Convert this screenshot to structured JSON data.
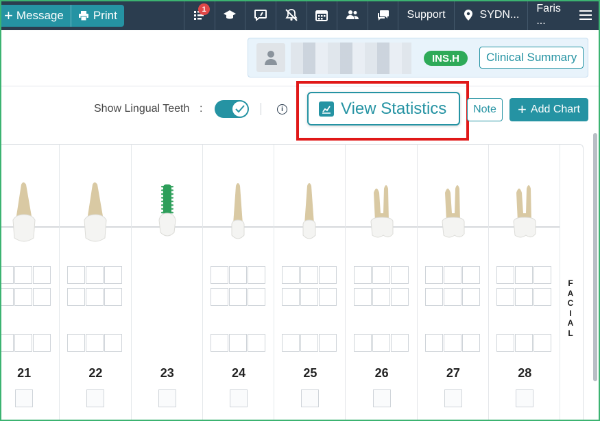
{
  "topnav": {
    "message_label": "Message",
    "print_label": "Print",
    "notification_count": "1",
    "support_label": "Support",
    "location_label": "SYDN...",
    "user_label": "Faris ..."
  },
  "patient": {
    "ins_badge": "INS.H",
    "clinical_summary_label": "Clinical Summary"
  },
  "toolbar": {
    "lingual_label": "Show Lingual Teeth",
    "colon": ":",
    "lingual_enabled": true,
    "view_statistics_label": "View Statistics",
    "note_label": "Note",
    "add_chart_label": "Add Chart"
  },
  "chart": {
    "teeth": [
      {
        "number": "21",
        "type": "incisor"
      },
      {
        "number": "22",
        "type": "incisor"
      },
      {
        "number": "23",
        "type": "implant"
      },
      {
        "number": "24",
        "type": "premolar"
      },
      {
        "number": "25",
        "type": "premolar"
      },
      {
        "number": "26",
        "type": "molar"
      },
      {
        "number": "27",
        "type": "molar"
      },
      {
        "number": "28",
        "type": "molar"
      }
    ],
    "side_label": "FACIAL",
    "colors": {
      "accent": "#2593a3",
      "nav": "#2b3d4f",
      "implant": "#2e9e5a",
      "highlight": "#e01818"
    }
  }
}
